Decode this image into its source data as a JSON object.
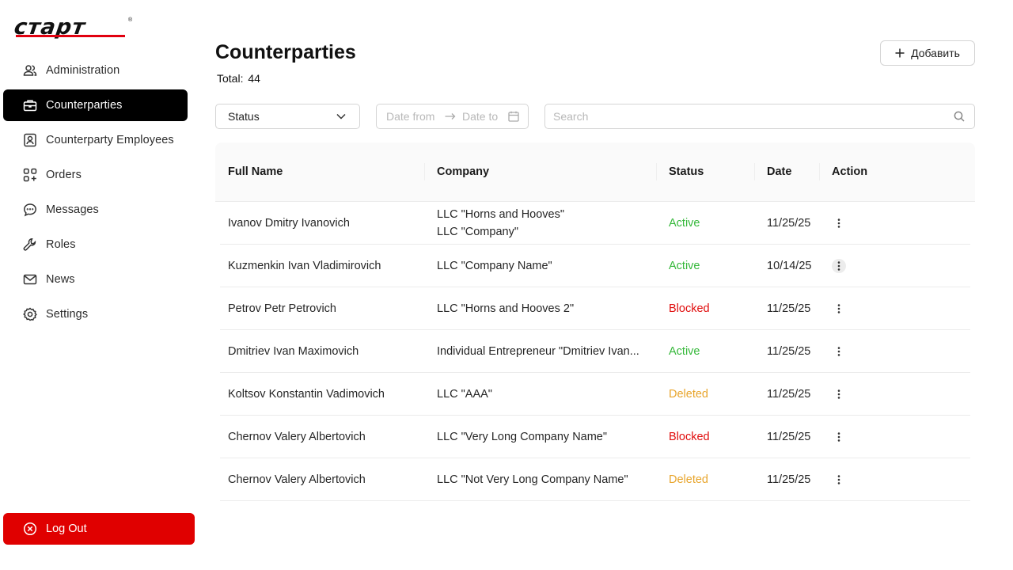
{
  "brand": {
    "logo_text": "старт",
    "logo_mark": "®",
    "accent": "#e1000f"
  },
  "sidebar": {
    "items": [
      {
        "label": "Administration",
        "icon": "users-icon"
      },
      {
        "label": "Counterparties",
        "icon": "briefcase-icon",
        "active": true
      },
      {
        "label": "Counterparty Employees",
        "icon": "contact-card-icon"
      },
      {
        "label": "Orders",
        "icon": "grid-plus-icon"
      },
      {
        "label": "Messages",
        "icon": "chat-bubble-icon"
      },
      {
        "label": "Roles",
        "icon": "wrench-icon"
      },
      {
        "label": "News",
        "icon": "mail-icon"
      },
      {
        "label": "Settings",
        "icon": "gear-icon"
      }
    ],
    "logout": {
      "label": "Log Out",
      "icon": "close-circle-icon",
      "color": "#e00000"
    }
  },
  "header": {
    "title": "Counterparties",
    "total_label": "Total:",
    "total_count": "44",
    "add_button": "Добавить"
  },
  "filters": {
    "status_select": {
      "value": "Status"
    },
    "date_from_placeholder": "Date from",
    "date_to_placeholder": "Date to",
    "search_placeholder": "Search"
  },
  "table": {
    "columns": [
      "Full Name",
      "Company",
      "Status",
      "Date",
      "Action"
    ],
    "rows": [
      {
        "name": "Ivanov Dmitry Ivanovich",
        "company": [
          "LLC \"Horns and Hooves\"",
          "LLC \"Company\""
        ],
        "status": "Active",
        "date": "11/25/25"
      },
      {
        "name": "Kuzmenkin Ivan Vladimirovich",
        "company": [
          "LLC \"Company Name\""
        ],
        "status": "Active",
        "date": "10/14/25",
        "action_highlight": true
      },
      {
        "name": "Petrov Petr Petrovich",
        "company": [
          "LLC \"Horns and Hooves 2\""
        ],
        "status": "Blocked",
        "date": "11/25/25"
      },
      {
        "name": "Dmitriev Ivan Maximovich",
        "company": [
          "Individual Entrepreneur \"Dmitriev Ivan..."
        ],
        "status": "Active",
        "date": "11/25/25"
      },
      {
        "name": "Koltsov Konstantin Vadimovich",
        "company": [
          "LLC \"AAA\""
        ],
        "status": "Deleted",
        "date": "11/25/25"
      },
      {
        "name": "Chernov Valery Albertovich",
        "company": [
          "LLC \"Very Long Company Name\""
        ],
        "status": "Blocked",
        "date": "11/25/25"
      },
      {
        "name": "Chernov Valery Albertovich",
        "company": [
          "LLC \"Not Very Long Company Name\""
        ],
        "status": "Deleted",
        "date": "11/25/25"
      }
    ]
  },
  "status_colors": {
    "Active": "#35b83a",
    "Blocked": "#e00d0d",
    "Deleted": "#e8a52c"
  }
}
